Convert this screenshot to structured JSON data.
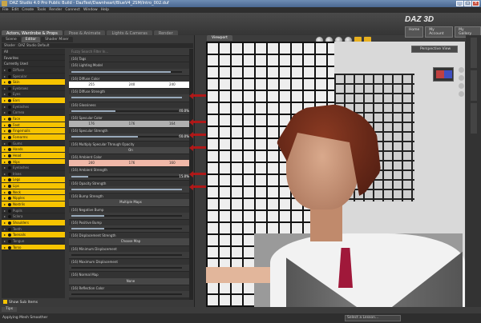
{
  "window": {
    "title": "DAZ Studio 4.0 Pro Public Build - DazTest/Dawnheart/BlueV4_2SM/Intro_002.duf"
  },
  "menu": [
    "File",
    "Edit",
    "Create",
    "Tools",
    "Render",
    "Connect",
    "Window",
    "Help"
  ],
  "top": {
    "logo": "DAZ 3D",
    "links": [
      "Home",
      "My Account",
      "My Gallery"
    ],
    "rooms": [
      "Actors, Wardrobe & Props",
      "Pose & Animate",
      "Lights & Cameras",
      "Render"
    ]
  },
  "left": {
    "tabs": [
      "Scene",
      "Editor",
      "Shader Mixer"
    ],
    "selection": "Shader : DAZ Studio Default",
    "groups": [
      {
        "label": "All",
        "hl": false,
        "pad": true
      },
      {
        "label": "Favorites",
        "hl": false,
        "pad": true
      },
      {
        "label": "Currently Used",
        "hl": false,
        "pad": true
      },
      {
        "label": "Diffuse",
        "hl": false
      },
      {
        "label": "Specular",
        "hl": false
      },
      {
        "label": "Skin",
        "hl": true
      },
      {
        "label": "Eyebrows",
        "hl": false
      },
      {
        "label": "Eyes",
        "hl": false
      },
      {
        "label": "Ears",
        "hl": true
      },
      {
        "label": "Eyelashes",
        "hl": false
      },
      {
        "label": "Cornea",
        "hl": false
      },
      {
        "label": "Face",
        "hl": true
      },
      {
        "label": "Feet",
        "hl": true
      },
      {
        "label": "Fingernails",
        "hl": true
      },
      {
        "label": "Forearms",
        "hl": true
      },
      {
        "label": "Gums",
        "hl": false
      },
      {
        "label": "Hands",
        "hl": true
      },
      {
        "label": "Head",
        "hl": true
      },
      {
        "label": "Hips",
        "hl": true
      },
      {
        "label": "Eyelashes",
        "hl": false
      },
      {
        "label": "Irises",
        "hl": false
      },
      {
        "label": "Legs",
        "hl": true
      },
      {
        "label": "Lips",
        "hl": true
      },
      {
        "label": "Neck",
        "hl": true
      },
      {
        "label": "Nipples",
        "hl": true
      },
      {
        "label": "Nostrils",
        "hl": true
      },
      {
        "label": "Pupils",
        "hl": false
      },
      {
        "label": "Sclera",
        "hl": false
      },
      {
        "label": "Shoulders",
        "hl": true
      },
      {
        "label": "Teeth",
        "hl": false
      },
      {
        "label": "Toenails",
        "hl": true
      },
      {
        "label": "Tongue",
        "hl": false
      },
      {
        "label": "Torso",
        "hl": true
      }
    ],
    "show_sub": "Show Sub Items",
    "tips": "Tips"
  },
  "props": {
    "rows": [
      {
        "kind": "field",
        "text": "Fuzzy Search Filter In..."
      },
      {
        "kind": "lbl",
        "text": "(16) Tags"
      },
      {
        "kind": "lbl",
        "text": "(16) Lighting Model"
      },
      {
        "kind": "ctrl",
        "text": "",
        "fill": 0.9
      },
      {
        "kind": "lbl",
        "text": "(16) Diffuse Color"
      },
      {
        "kind": "color",
        "c": [
          "255",
          "240",
          "240"
        ],
        "tone": "white"
      },
      {
        "kind": "lbl",
        "text": "(16) Diffuse Strength"
      },
      {
        "kind": "ctrl",
        "text": "",
        "fill": 1.0
      },
      {
        "kind": "lbl",
        "text": "(16) Glossiness"
      },
      {
        "kind": "ctrl",
        "text": "",
        "fill": 0.4,
        "val": "40.0%"
      },
      {
        "kind": "lbl",
        "text": "(16) Specular Color"
      },
      {
        "kind": "color",
        "c": [
          "176",
          "176",
          "164"
        ],
        "tone": "grey"
      },
      {
        "kind": "lbl",
        "text": "(16) Specular Strength"
      },
      {
        "kind": "ctrl",
        "text": "",
        "fill": 0.6,
        "val": "60.0%"
      },
      {
        "kind": "lbl",
        "text": "(16) Multiply Specular Through Opacity"
      },
      {
        "kind": "btn",
        "text": "On"
      },
      {
        "kind": "lbl",
        "text": "(16) Ambient Color"
      },
      {
        "kind": "color",
        "c": [
          "240",
          "176",
          "160"
        ],
        "tone": "pink"
      },
      {
        "kind": "lbl",
        "text": "(16) Ambient Strength"
      },
      {
        "kind": "ctrl",
        "text": "",
        "fill": 0.15,
        "val": "15.0%"
      },
      {
        "kind": "lbl",
        "text": "(16) Opacity Strength"
      },
      {
        "kind": "ctrl",
        "text": "",
        "fill": 1.0
      },
      {
        "kind": "lbl",
        "text": "(16) Bump Strength"
      },
      {
        "kind": "btn",
        "text": "Multiple Maps"
      },
      {
        "kind": "lbl",
        "text": "(16) Negative Bump"
      },
      {
        "kind": "ctrl",
        "text": "",
        "fill": 0.3
      },
      {
        "kind": "lbl",
        "text": "(16) Positive Bump"
      },
      {
        "kind": "ctrl",
        "text": "",
        "fill": 0.3
      },
      {
        "kind": "lbl",
        "text": "(16) Displacement Strength"
      },
      {
        "kind": "btn",
        "text": "Choose Map"
      },
      {
        "kind": "lbl",
        "text": "(16) Minimum Displacement"
      },
      {
        "kind": "ctrl",
        "text": "",
        "fill": 0.0
      },
      {
        "kind": "lbl",
        "text": "(16) Maximum Displacement"
      },
      {
        "kind": "ctrl",
        "text": "",
        "fill": 0.0
      },
      {
        "kind": "lbl",
        "text": "(16) Normal Map"
      },
      {
        "kind": "btn",
        "text": "None"
      },
      {
        "kind": "lbl",
        "text": "(16) Reflection Color"
      },
      {
        "kind": "ctrl",
        "text": "",
        "fill": 0.0
      }
    ]
  },
  "viewport": {
    "tab": "Viewport",
    "camera": "Perspective View"
  },
  "status": {
    "message": "Applying Mesh Smoother",
    "lesson": "Select a Lesson..."
  }
}
